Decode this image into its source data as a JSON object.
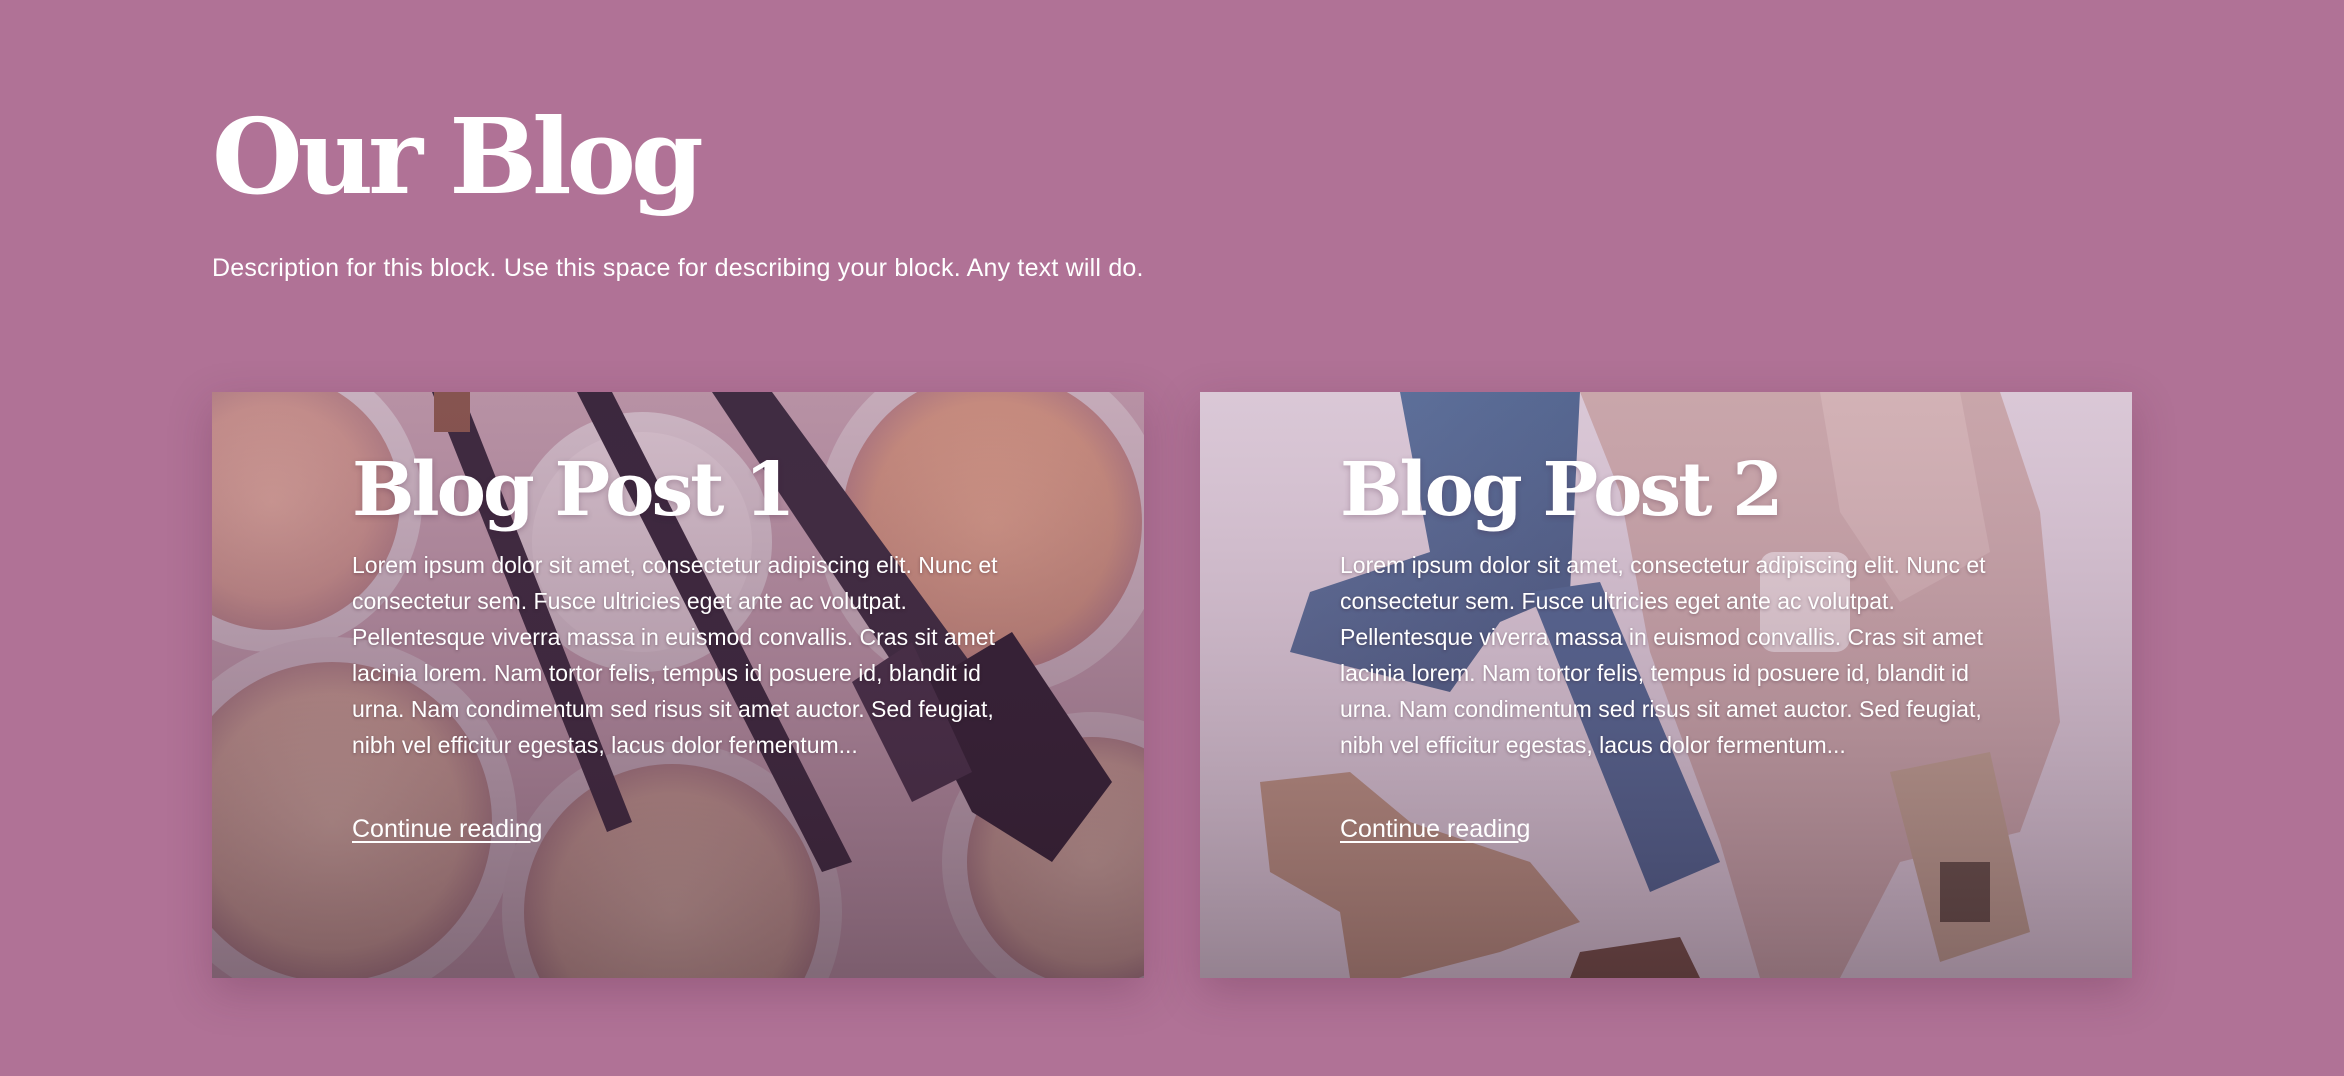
{
  "header": {
    "title": "Our Blog",
    "description": "Description for this block. Use this space for describing your block. Any text will do."
  },
  "posts": [
    {
      "title": "Blog Post 1",
      "excerpt": "Lorem ipsum dolor sit amet, consectetur adipiscing elit. Nunc et consectetur sem. Fusce ultricies eget ante ac volutpat. Pellentesque viverra massa in euismod convallis. Cras sit amet lacinia lorem. Nam tortor felis, tempus id posuere id, blandit id urna. Nam condimentum sed risus sit amet auctor. Sed feugiat, nibh vel efficitur egestas, lacus dolor fermentum...",
      "link_label": "Continue reading"
    },
    {
      "title": "Blog Post 2",
      "excerpt": "Lorem ipsum dolor sit amet, consectetur adipiscing elit. Nunc et consectetur sem. Fusce ultricies eget ante ac volutpat. Pellentesque viverra massa in euismod convallis. Cras sit amet lacinia lorem. Nam tortor felis, tempus id posuere id, blandit id urna. Nam condimentum sed risus sit amet auctor. Sed feugiat, nibh vel efficitur egestas, lacus dolor fermentum...",
      "link_label": "Continue reading"
    }
  ],
  "colors": {
    "background": "#b07296",
    "text": "#ffffff"
  }
}
